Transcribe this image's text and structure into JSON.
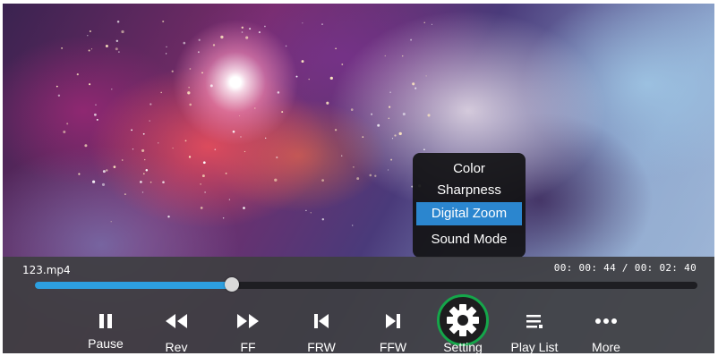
{
  "player": {
    "file_name": "123.mp4",
    "time_display": "00: 00: 44 / 00: 02: 40",
    "progress": 0.297
  },
  "settings_menu": {
    "items": [
      {
        "label": "Color",
        "selected": false
      },
      {
        "label": "Sharpness",
        "selected": false
      },
      {
        "label": "Digital Zoom",
        "selected": true
      },
      {
        "label": "Sound Mode",
        "selected": false
      }
    ]
  },
  "controls": [
    {
      "label": "Pause",
      "icon": "pause-icon"
    },
    {
      "label": "Rev",
      "icon": "rewind-icon"
    },
    {
      "label": "FF",
      "icon": "fast-forward-icon"
    },
    {
      "label": "FRW",
      "icon": "skip-previous-icon"
    },
    {
      "label": "FFW",
      "icon": "skip-next-icon"
    },
    {
      "label": "Setting",
      "icon": "gear-icon"
    },
    {
      "label": "Play List",
      "icon": "playlist-icon"
    },
    {
      "label": "More",
      "icon": "more-icon"
    }
  ],
  "colors": {
    "progress": "#2d9fe0",
    "selected": "#2b86cf",
    "settings_ring": "#15a64a"
  }
}
